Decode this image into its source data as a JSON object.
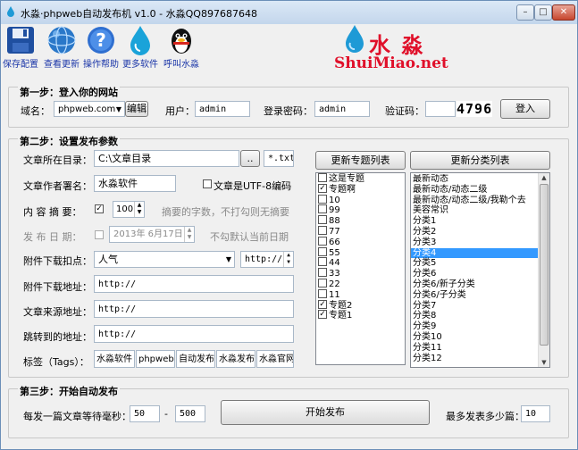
{
  "window": {
    "title": "水淼·phpweb自动发布机 v1.0 - 水淼QQ897687648",
    "controls": [
      "–",
      "□",
      "✕"
    ]
  },
  "toolbar": {
    "items": [
      {
        "label": "保存配置",
        "icon": "floppy-disk-icon"
      },
      {
        "label": "查看更新",
        "icon": "globe-icon"
      },
      {
        "label": "操作帮助",
        "icon": "help-icon"
      },
      {
        "label": "更多软件",
        "icon": "water-drop-icon"
      },
      {
        "label": "呼叫水淼",
        "icon": "qq-penguin-icon"
      }
    ]
  },
  "brand": {
    "name_cn": "水 淼",
    "name_en": "ShuiMiao.net",
    "color_red": "#e0102a",
    "color_blue": "#1e9ad6"
  },
  "step1": {
    "title": "第一步：登入你的网站",
    "domain_label": "域名：",
    "domain_value": "phpweb.com",
    "edit_button": "编辑",
    "user_label": "用户：",
    "user_value": "admin",
    "password_label": "登录密码：",
    "password_value": "admin",
    "captcha_label": "验证码：",
    "captcha_value": "",
    "captcha_image_text": "4796",
    "login_button": "登入"
  },
  "step2": {
    "title": "第二步：设置发布参数",
    "dir_label": "文章所在目录：",
    "dir_value": "C:\\文章目录",
    "browse_button": "..",
    "ext_value": "*.txt",
    "author_label": "文章作者署名：",
    "author_value": "水淼软件",
    "utf8_label": "文章是UTF-8编码",
    "summary_label": "内 容 摘 要：",
    "summary_value": "100",
    "summary_hint": "摘要的字数，不打勾则无摘要",
    "date_label": "发 布 日 期：",
    "date_value": "2013年  6月17日",
    "date_hint": "不勾默认当前日期",
    "attach_points_label": "附件下载扣点：",
    "attach_points_value": "人气",
    "attach_points_url": "http://",
    "attach_url_label": "附件下载地址：",
    "attach_url_value": "http://",
    "source_label": "文章来源地址：",
    "source_value": "http://",
    "redirect_label": "跳转到的地址：",
    "redirect_value": "http://",
    "tags_label": "标签（Tags）：",
    "tags": [
      "水淼软件",
      "phpweb",
      "自动发布",
      "水淼发布",
      "水淼官网"
    ],
    "refresh_topics_button": "更新专题列表",
    "refresh_categories_button": "更新分类列表",
    "topics": [
      {
        "label": "这是专题",
        "checked": false
      },
      {
        "label": "专题啊",
        "checked": true
      },
      {
        "label": "10",
        "checked": false
      },
      {
        "label": "99",
        "checked": false
      },
      {
        "label": "88",
        "checked": false
      },
      {
        "label": "77",
        "checked": false
      },
      {
        "label": "66",
        "checked": false
      },
      {
        "label": "55",
        "checked": false
      },
      {
        "label": "44",
        "checked": false
      },
      {
        "label": "33",
        "checked": false
      },
      {
        "label": "22",
        "checked": false
      },
      {
        "label": "11",
        "checked": false
      },
      {
        "label": "专题2",
        "checked": true
      },
      {
        "label": "专题1",
        "checked": true
      }
    ],
    "categories": [
      "最新动态",
      "最新动态/动态二级",
      "最新动态/动态二级/我勒个去",
      "美容常识",
      "分类1",
      "分类2",
      "分类3",
      "分类4",
      "分类5",
      "分类6",
      "分类6/新子分类",
      "分类6/子分类",
      "分类7",
      "分类8",
      "分类9",
      "分类10",
      "分类11",
      "分类12"
    ],
    "selected_category": "分类4"
  },
  "step3": {
    "title": "第三步：开始自动发布",
    "wait_label": "每发一篇文章等待毫秒：",
    "wait_min": "50",
    "dash": "-",
    "wait_max": "500",
    "start_button": "开始发布",
    "max_label": "最多发表多少篇：",
    "max_value": "10"
  }
}
